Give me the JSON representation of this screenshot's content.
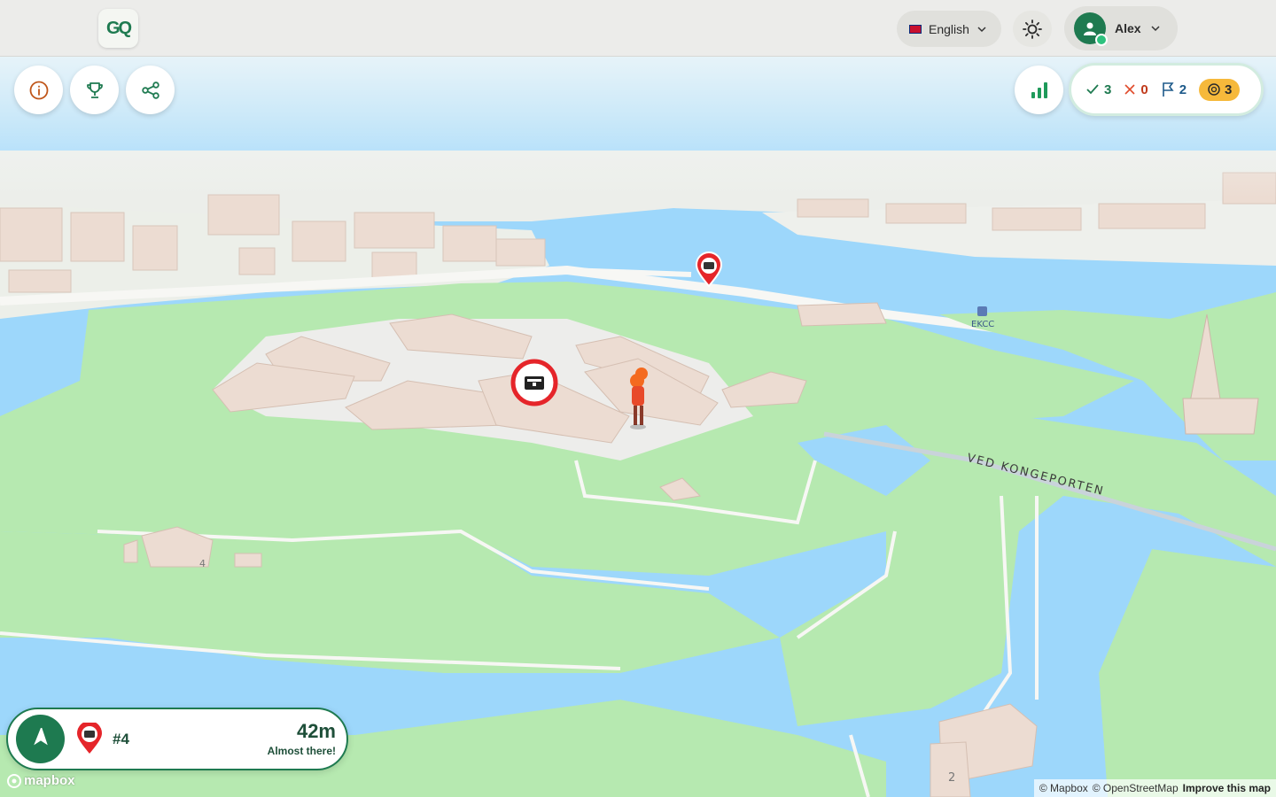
{
  "header": {
    "logo_text": "GQ",
    "language": "English",
    "username": "Alex"
  },
  "toolbar": {
    "info_icon": "info-icon",
    "trophy_icon": "trophy-icon",
    "share_icon": "share-icon",
    "leaderboard_icon": "bar-chart-icon"
  },
  "stats": {
    "correct": "3",
    "wrong": "0",
    "flags": "2",
    "coins": "3"
  },
  "map": {
    "street_label": "VED KONGEPORTEN",
    "poi_label": "EKCC",
    "building_number_1": "4",
    "building_number_2": "2"
  },
  "navigation": {
    "target": "#4",
    "distance": "42m",
    "message": "Almost there!"
  },
  "attribution": {
    "mapbox_logo": "mapbox",
    "mapbox": "© Mapbox",
    "osm": "© OpenStreetMap",
    "improve": "Improve this map"
  },
  "colors": {
    "brand_green": "#1e7a50",
    "water": "#9dd7fb",
    "land": "#b6e9b0",
    "marker_red": "#e5252a",
    "coin_gold": "#f6b93b"
  }
}
